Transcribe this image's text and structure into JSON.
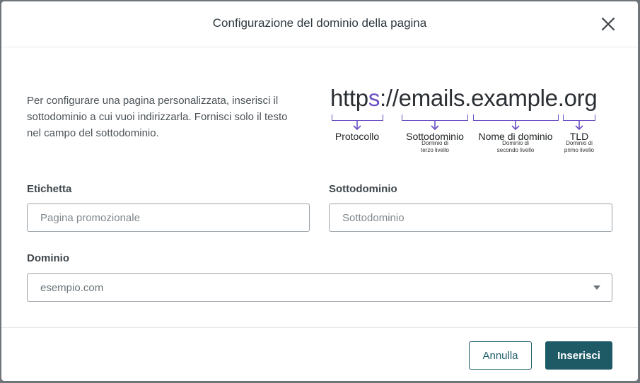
{
  "modal": {
    "title": "Configurazione del dominio della pagina",
    "close_icon": "close-icon",
    "intro": "Per configurare una pagina personalizzata, inserisci il sottodominio a cui vuoi indirizzarla. Fornisci solo il testo nel campo del sottodominio."
  },
  "diagram": {
    "url_protocol": "http",
    "url_highlight": "s",
    "url_rest": "://emails.example.org",
    "parts": [
      {
        "label": "Protocollo",
        "sub": ""
      },
      {
        "label": "Sottodominio",
        "sub_line1": "Dominio di",
        "sub_line2": "terzo livello"
      },
      {
        "label": "Nome di dominio",
        "sub_line1": "Dominio di",
        "sub_line2": "secondo livello"
      },
      {
        "label": "TLD",
        "sub_line1": "Dominio di",
        "sub_line2": "primo livello"
      }
    ],
    "accent_color": "#6a4fc2"
  },
  "form": {
    "label_field": {
      "label": "Etichetta",
      "placeholder": "Pagina promozionale",
      "value": ""
    },
    "subdomain_field": {
      "label": "Sottodominio",
      "placeholder": "Sottodominio",
      "value": ""
    },
    "domain_field": {
      "label": "Dominio",
      "selected": "esempio.com"
    }
  },
  "footer": {
    "cancel_label": "Annulla",
    "insert_label": "Inserisci",
    "primary_color": "#1e5a66"
  }
}
